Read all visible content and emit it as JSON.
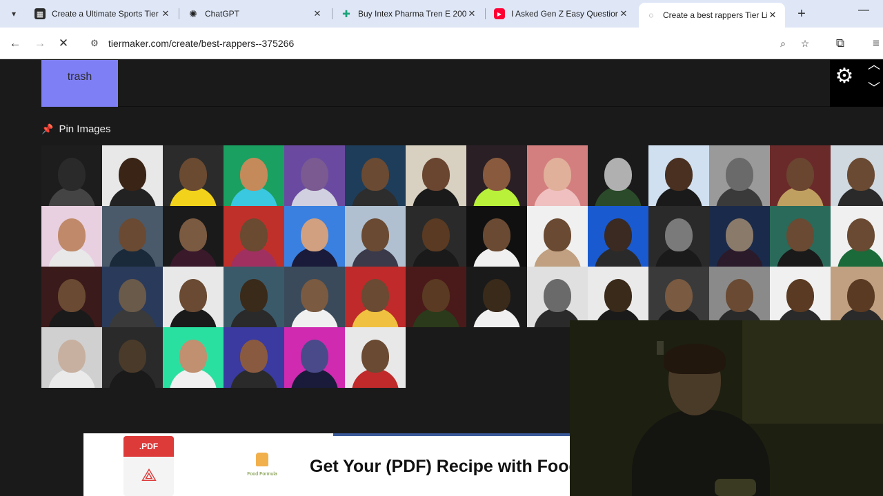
{
  "browser": {
    "tabs": [
      {
        "title": "Create a Ultimate Sports Tier",
        "favicon": "tiermaker-icon",
        "color": "#2b2b2b"
      },
      {
        "title": "ChatGPT",
        "favicon": "chatgpt-icon",
        "color": "#1f1f1f"
      },
      {
        "title": "Buy Intex Pharma Tren E 200",
        "favicon": "puzzle-icon",
        "color": "#1aa37a"
      },
      {
        "title": "I Asked Gen Z Easy Question",
        "favicon": "youtube-icon",
        "color": "#ff0033"
      },
      {
        "title": "Create a best rappers Tier Li",
        "favicon": "loading-icon",
        "color": "#555555",
        "active": true
      }
    ],
    "url": "tiermaker.com/create/best-rappers--375266"
  },
  "tier": {
    "label": "trash",
    "label_color": "#7f7ff5"
  },
  "pin_images": {
    "title": "Pin Images"
  },
  "tiles": [
    [
      "#1d1d1d",
      "#2a2a2a",
      "#444"
    ],
    [
      "#e8e8e8",
      "#3a2416",
      "#222"
    ],
    [
      "#2b2b2b",
      "#6b4a32",
      "#f2d21a"
    ],
    [
      "#1aa060",
      "#c48a5a",
      "#3ac7e0"
    ],
    [
      "#6a4aa0",
      "#7a5a90",
      "#d0d0e0"
    ],
    [
      "#1e3d5a",
      "#6a4a32",
      "#2d2d2d"
    ],
    [
      "#d8d0c0",
      "#6a4530",
      "#1a1a1a"
    ],
    [
      "#2a1f24",
      "#8a5a3e",
      "#b8f03a"
    ],
    [
      "#d47f7f",
      "#e0b09a",
      "#f0c0c0"
    ],
    [
      "#1a1a1a",
      "#b0b0b0",
      "#2a4a2a"
    ],
    [
      "#d0e0f0",
      "#4a3020",
      "#1a1a1a"
    ],
    [
      "#9a9a9a",
      "#6a6a6a",
      "#3a3a3a"
    ],
    [
      "#6a2a2a",
      "#6a4530",
      "#c0a060"
    ],
    [
      "#d0d8e0",
      "#6a4a32",
      "#2a2a2a"
    ],
    [
      "#e8d0e0",
      "#c08a6a",
      "#e8e8e8"
    ],
    [
      "#4a5a6a",
      "#6a4a32",
      "#1a2a3a"
    ],
    [
      "#1a1a1a",
      "#7a5a40",
      "#3a1a2a"
    ],
    [
      "#c0302a",
      "#6a4a30",
      "#a03060"
    ],
    [
      "#3a80e0",
      "#d0a080",
      "#1a1a3a"
    ],
    [
      "#b0c0d0",
      "#6a4a32",
      "#3a3a4a"
    ],
    [
      "#2a2a2a",
      "#5a3a22",
      "#1a1a1a"
    ],
    [
      "#101010",
      "#6a4a32",
      "#f0f0f0"
    ],
    [
      "#f0f0f0",
      "#6a4a32",
      "#c0a080"
    ],
    [
      "#1a5ad0",
      "#3a2a22",
      "#2a2a2a"
    ],
    [
      "#2a2a2a",
      "#7a7a7a",
      "#1a1a1a"
    ],
    [
      "#1a2a4a",
      "#8a7a6a",
      "#2a1a2a"
    ],
    [
      "#2a6a5a",
      "#6a4a32",
      "#1a1a1a"
    ],
    [
      "#f0f0f0",
      "#6a4a32",
      "#1a6a3a"
    ],
    [
      "#3a1a1a",
      "#6a4a32",
      "#1a1a1a"
    ],
    [
      "#2a3a5a",
      "#6a5a4a",
      "#3a3a3a"
    ],
    [
      "#e8e8e8",
      "#6a4a32",
      "#1a1a1a"
    ],
    [
      "#3a5a6a",
      "#3a2a1a",
      "#2a2a2a"
    ],
    [
      "#3a4a5a",
      "#7a5a40",
      "#f0f0f0"
    ],
    [
      "#c02a2a",
      "#6a4a32",
      "#f0c040"
    ],
    [
      "#4a1a1a",
      "#5a3a22",
      "#2a3a1a"
    ],
    [
      "#1a1a1a",
      "#3a2a1a",
      "#f0f0f0"
    ],
    [
      "#e0e0e0",
      "#6a6a6a",
      "#2a2a2a"
    ],
    [
      "#eaeaea",
      "#3a2a1a",
      "#1a1a1a"
    ],
    [
      "#3a3a3a",
      "#7a5a40",
      "#1a1a1a"
    ],
    [
      "#8a8a8a",
      "#6a4a32",
      "#2a2a2a"
    ],
    [
      "#f0f0f0",
      "#5a3a22",
      "#2a2a2a"
    ],
    [
      "#c0a080",
      "#5a3a22",
      "#2a2a2a"
    ],
    [
      "#d0d0d0",
      "#c8b0a0",
      "#eaeaea"
    ],
    [
      "#2a2a2a",
      "#4a3a2a",
      "#1a1a1a"
    ],
    [
      "#2ae0a0",
      "#c09070",
      "#f0f0f0"
    ],
    [
      "#3a3aa0",
      "#8a5a40",
      "#2a2a2a"
    ],
    [
      "#d02ab0",
      "#4a4a8a",
      "#1a1a3a"
    ],
    [
      "#e8e8e8",
      "#6a4a32",
      "#c02a2a"
    ]
  ],
  "ad": {
    "pdf_label": ".PDF",
    "brand": "Food Formula",
    "headline": "Get Your (PDF) Recipe with Food"
  },
  "colors": {
    "tabstrip": "#dfe7f7",
    "page_bg": "#1a1a1a",
    "pin_icon": "#e23b3b"
  }
}
